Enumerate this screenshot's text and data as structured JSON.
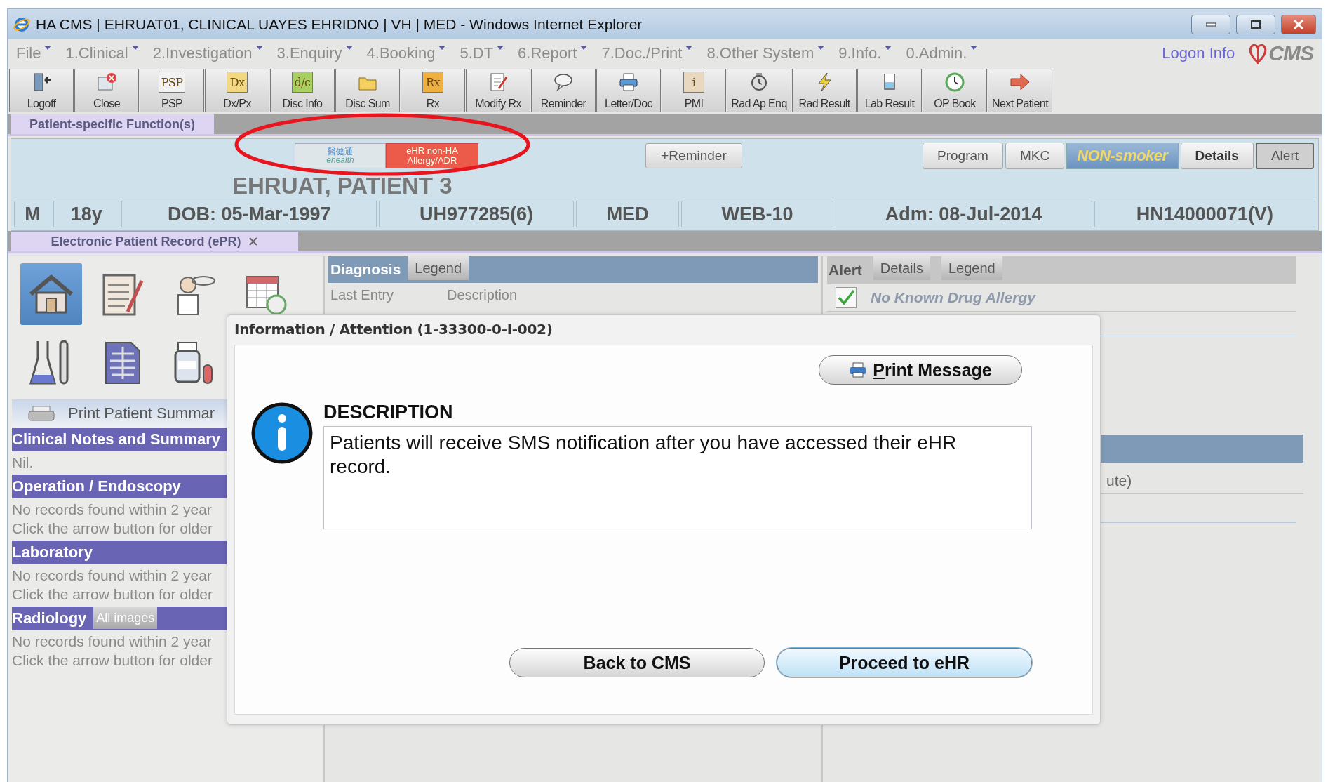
{
  "window": {
    "title": "HA CMS | EHRUAT01, CLINICAL UAYES EHRIDNO | VH | MED - Windows Internet Explorer"
  },
  "menu": [
    "File",
    "1.Clinical",
    "2.Investigation",
    "3.Enquiry",
    "4.Booking",
    "5.DT",
    "6.Report",
    "7.Doc./Print",
    "8.Other System",
    "9.Info.",
    "0.Admin."
  ],
  "header_links": {
    "logon_info": "Logon Info",
    "logo": "CMS"
  },
  "toolbar": [
    {
      "label": "Logoff"
    },
    {
      "label": "Close"
    },
    {
      "label": "PSP",
      "icon_text": "PSP"
    },
    {
      "label": "Dx/Px",
      "icon_text": "Dx"
    },
    {
      "label": "Disc Info",
      "icon_text": "d/c"
    },
    {
      "label": "Disc Sum"
    },
    {
      "label": "Rx",
      "icon_text": "Rx"
    },
    {
      "label": "Modify Rx"
    },
    {
      "label": "Reminder"
    },
    {
      "label": "Letter/Doc"
    },
    {
      "label": "PMI",
      "icon_text": "i"
    },
    {
      "label": "Rad Ap Enq"
    },
    {
      "label": "Rad Result"
    },
    {
      "label": "Lab Result"
    },
    {
      "label": "OP Book"
    },
    {
      "label": "Next Patient"
    }
  ],
  "function_tab": "Patient-specific Function(s)",
  "patient_banner": {
    "ehealth": {
      "chinese": "醫健通",
      "latin": "ehealth"
    },
    "ehr_button": "eHR non-HA Allergy/ADR",
    "reminder": "+Reminder",
    "buttons": [
      {
        "label": "Program",
        "kind": "button",
        "selected": false,
        "bold": false
      },
      {
        "label": "MKC",
        "kind": "button",
        "selected": false,
        "bold": false
      },
      {
        "label": "NON-smoker",
        "kind": "badge",
        "selected": false,
        "bold": true
      },
      {
        "label": "Details",
        "kind": "button",
        "selected": false,
        "bold": true
      },
      {
        "label": "Alert",
        "kind": "button",
        "selected": true,
        "bold": false
      }
    ],
    "name": "EHRUAT, PATIENT 3",
    "info": [
      "M",
      "18y",
      "DOB: 05-Mar-1997",
      "UH977285(6)",
      "MED",
      "WEB-10",
      "Adm: 08-Jul-2014",
      "HN14000071(V)"
    ]
  },
  "epr_tab": "Electronic Patient Record (ePR)",
  "left_panel": {
    "icons": [
      {
        "selected": true
      },
      {
        "selected": false
      },
      {
        "selected": false
      },
      {
        "selected": false
      },
      {
        "selected": false
      },
      {
        "selected": false
      },
      {
        "selected": false
      }
    ],
    "print_summary": "Print Patient Summar",
    "sections": [
      {
        "title": "Clinical Notes and Summary",
        "lines": [
          "Nil."
        ]
      },
      {
        "title": "Operation / Endoscopy",
        "lines": [
          "No records found within 2 year",
          "Click the arrow button for older"
        ]
      },
      {
        "title": "Laboratory",
        "lines": [
          "No records found within 2 year",
          "Click the arrow button for older"
        ]
      },
      {
        "title": "Radiology",
        "button": "All images",
        "lines": [
          "No records found within 2 year",
          "Click the arrow button for older"
        ]
      }
    ]
  },
  "diagnosis": {
    "title": "Diagnosis",
    "tabs": [
      "Legend"
    ],
    "columns": [
      "Last Entry",
      "Description"
    ]
  },
  "alert": {
    "title": "Alert",
    "tabs": [
      "Details",
      "Legend"
    ],
    "items": [
      {
        "label": "No Known Drug Allergy",
        "checked": true
      }
    ]
  },
  "lower_panel": {
    "fragment": "ute)"
  },
  "dialog": {
    "title": "Information / Attention (1-33300-0-I-002)",
    "print_button": "Print Message",
    "heading": "DESCRIPTION",
    "message": "Patients will receive SMS notification after you have accessed their eHR record.",
    "buttons": [
      {
        "label": "Back to CMS",
        "focused": false
      },
      {
        "label": "Proceed to eHR",
        "focused": true
      }
    ]
  }
}
